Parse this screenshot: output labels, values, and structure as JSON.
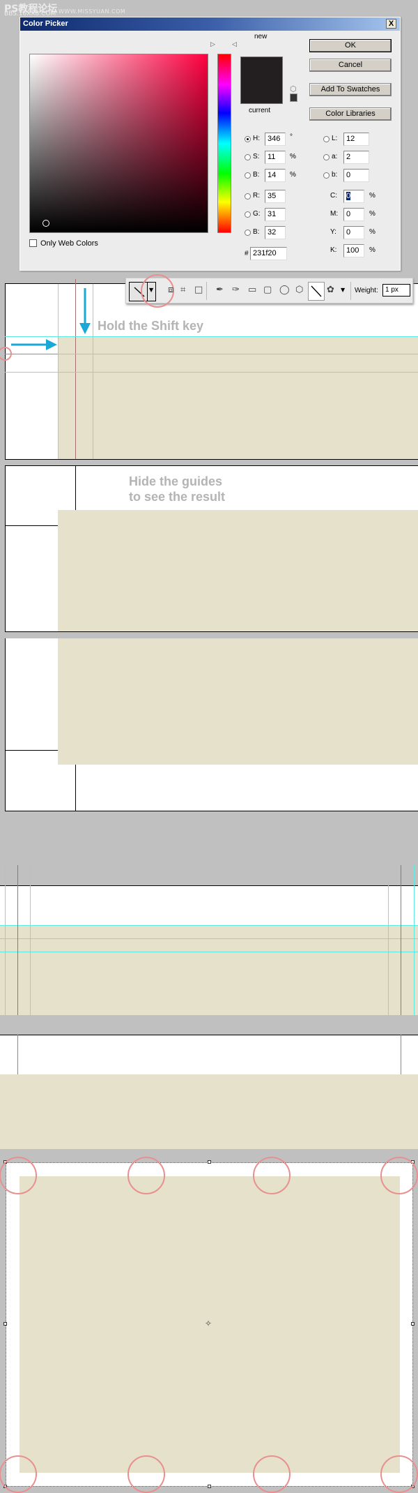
{
  "watermark": {
    "line1": "PS教程论坛",
    "line2": "BBS.16XX8.COM",
    "site": "WWW.MISSYUAN.COM"
  },
  "dialog": {
    "title": "Color Picker",
    "close_label": "X",
    "new_label": "new",
    "current_label": "current",
    "buttons": {
      "ok": "OK",
      "cancel": "Cancel",
      "add_to_swatches": "Add To Swatches",
      "color_libraries": "Color Libraries"
    },
    "only_web_colors": "Only Web Colors",
    "only_web_colors_checked": false,
    "color": "#231f20",
    "hsb": [
      {
        "label": "H:",
        "value": "346",
        "unit": "°",
        "selected": true
      },
      {
        "label": "S:",
        "value": "11",
        "unit": "%"
      },
      {
        "label": "B:",
        "value": "14",
        "unit": "%"
      }
    ],
    "rgb": [
      {
        "label": "R:",
        "value": "35"
      },
      {
        "label": "G:",
        "value": "31"
      },
      {
        "label": "B:",
        "value": "32"
      }
    ],
    "lab": [
      {
        "label": "L:",
        "value": "12"
      },
      {
        "label": "a:",
        "value": "2"
      },
      {
        "label": "b:",
        "value": "0"
      }
    ],
    "cmyk": [
      {
        "label": "C:",
        "value": "0",
        "unit": "%"
      },
      {
        "label": "M:",
        "value": "0",
        "unit": "%"
      },
      {
        "label": "Y:",
        "value": "0",
        "unit": "%"
      },
      {
        "label": "K:",
        "value": "100",
        "unit": "%"
      }
    ],
    "hex_label": "#",
    "hex": "231f20"
  },
  "toolbar": {
    "weight_label": "Weight:",
    "weight_value": "1 px",
    "active_tool": "line-tool"
  },
  "hints": {
    "shift": "Hold the Shift key",
    "guides_line1": "Hide the guides",
    "guides_line2": "to see the result"
  },
  "colors": {
    "beige": "#e6e1ca",
    "guide": "#5ee8e0",
    "arrow": "#1aa9d6",
    "highlight": "#e89090"
  }
}
